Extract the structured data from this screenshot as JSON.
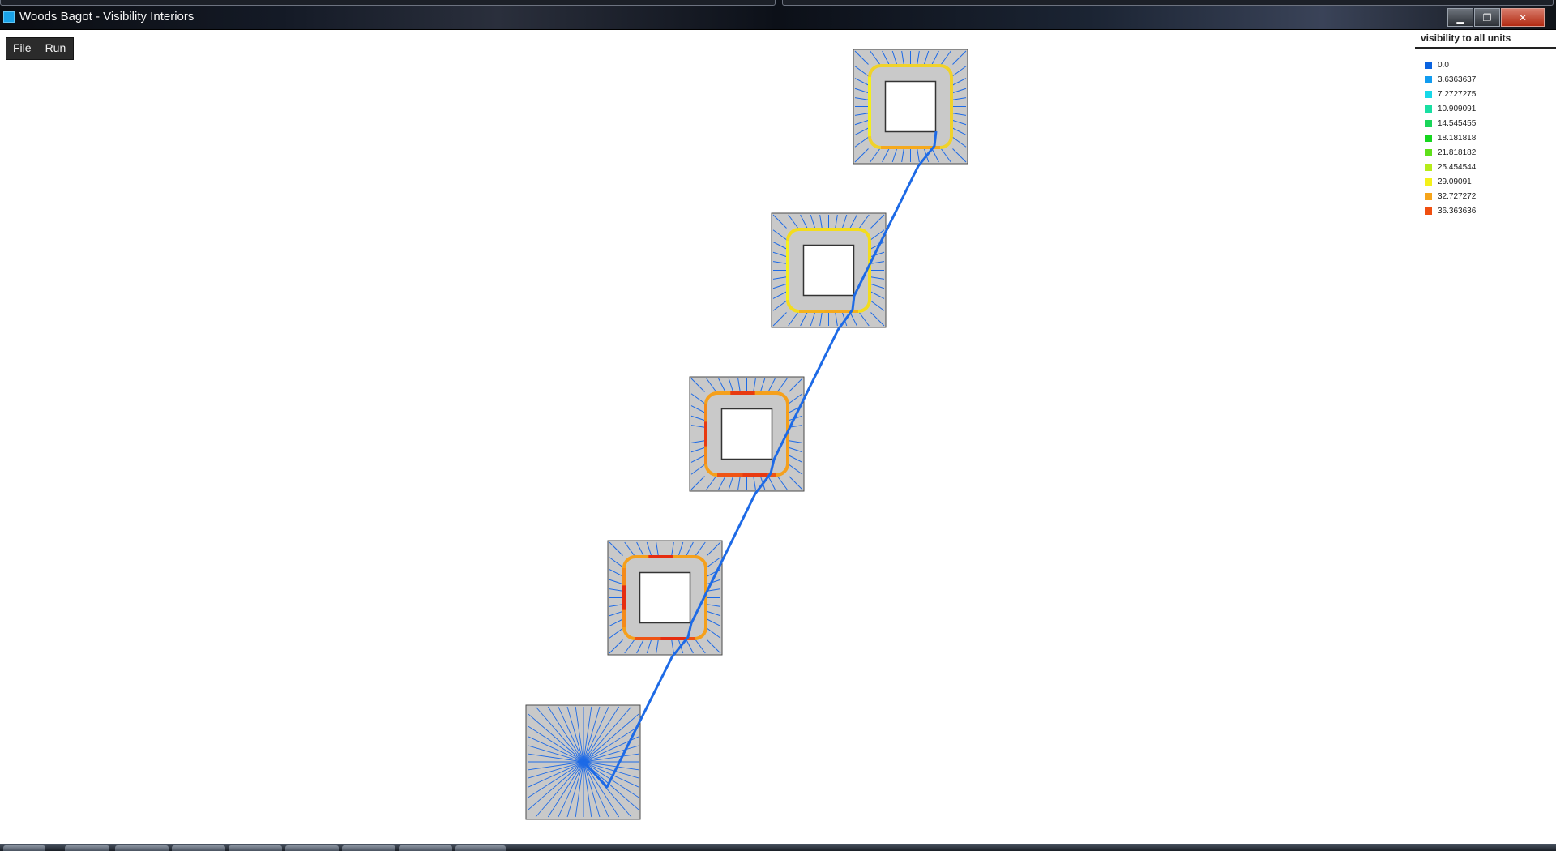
{
  "window": {
    "title": "Woods Bagot - Visibility Interiors",
    "buttons": {
      "minimize": "▁",
      "maximize": "❐",
      "close": "✕"
    }
  },
  "menu": {
    "file": "File",
    "run": "Run"
  },
  "legend": {
    "title": "visibility to all units",
    "items": [
      {
        "label": "0.0",
        "color": "#0a63e0"
      },
      {
        "label": "3.6363637",
        "color": "#119cf0"
      },
      {
        "label": "7.2727275",
        "color": "#17d8e8"
      },
      {
        "label": "10.909091",
        "color": "#19dfa2"
      },
      {
        "label": "14.545455",
        "color": "#1ad55a"
      },
      {
        "label": "18.181818",
        "color": "#16d61f"
      },
      {
        "label": "21.818182",
        "color": "#5fe01b"
      },
      {
        "label": "25.454544",
        "color": "#b6ec1a"
      },
      {
        "label": "29.09091",
        "color": "#f4f11a"
      },
      {
        "label": "32.727272",
        "color": "#f6a41a"
      },
      {
        "label": "36.363636",
        "color": "#f04f10"
      }
    ]
  }
}
